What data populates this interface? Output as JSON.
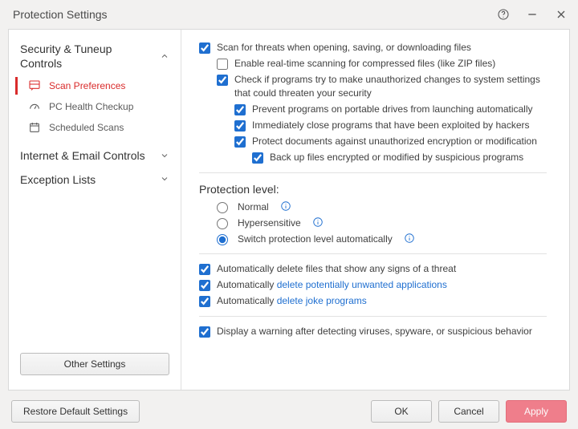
{
  "title": "Protection Settings",
  "sidebar": {
    "groups": [
      {
        "label": "Security & Tuneup Controls",
        "expanded": true,
        "items": [
          {
            "id": "scan-preferences",
            "label": "Scan Preferences",
            "active": true
          },
          {
            "id": "pc-health-checkup",
            "label": "PC Health Checkup",
            "active": false
          },
          {
            "id": "scheduled-scans",
            "label": "Scheduled Scans",
            "active": false
          }
        ]
      },
      {
        "label": "Internet & Email Controls",
        "expanded": false,
        "items": []
      },
      {
        "label": "Exception Lists",
        "expanded": false,
        "items": []
      }
    ],
    "other_settings_label": "Other Settings"
  },
  "main": {
    "cb_scan_threats": {
      "checked": true,
      "label": "Scan for threats when opening, saving, or downloading files"
    },
    "cb_realtime_compressed": {
      "checked": false,
      "label": "Enable real-time scanning for compressed files (like ZIP files)"
    },
    "cb_unauth_changes": {
      "checked": true,
      "label": "Check if programs try to make unauthorized changes to system settings that could threaten your security"
    },
    "cb_portable_drives": {
      "checked": true,
      "label": "Prevent programs on portable drives from launching automatically"
    },
    "cb_close_exploited": {
      "checked": true,
      "label": "Immediately close programs that have been exploited by hackers"
    },
    "cb_protect_docs": {
      "checked": true,
      "label": "Protect documents against unauthorized encryption or modification"
    },
    "cb_backup_encrypted": {
      "checked": true,
      "label": "Back up files encrypted or modified by suspicious programs"
    },
    "protection_level_title": "Protection level:",
    "radio_normal": "Normal",
    "radio_hypersensitive": "Hypersensitive",
    "radio_auto": "Switch protection level automatically",
    "radio_selected": "auto",
    "cb_auto_delete": {
      "checked": true,
      "label": "Automatically delete files that show any signs of a threat"
    },
    "cb_auto_pup": {
      "checked": true,
      "prefix": "Automatically ",
      "link": "delete potentially unwanted applications"
    },
    "cb_auto_joke": {
      "checked": true,
      "prefix": "Automatically ",
      "link": "delete joke programs"
    },
    "cb_display_warning": {
      "checked": true,
      "label": "Display a warning after detecting viruses, spyware, or suspicious behavior"
    }
  },
  "footer": {
    "restore": "Restore Default Settings",
    "ok": "OK",
    "cancel": "Cancel",
    "apply": "Apply"
  }
}
